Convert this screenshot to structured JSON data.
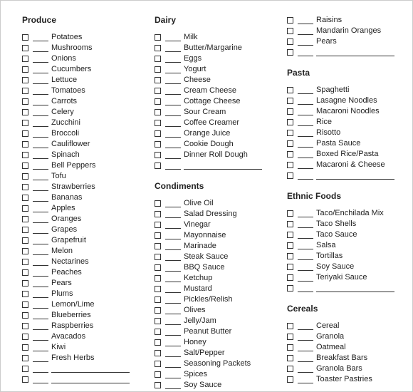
{
  "columns": [
    {
      "sections": [
        {
          "title": "Produce",
          "items": [
            {
              "label": "Potatoes"
            },
            {
              "label": "Mushrooms"
            },
            {
              "label": "Onions"
            },
            {
              "label": "Cucumbers"
            },
            {
              "label": "Lettuce"
            },
            {
              "label": "Tomatoes"
            },
            {
              "label": "Carrots"
            },
            {
              "label": "Celery"
            },
            {
              "label": "Zucchini"
            },
            {
              "label": "Broccoli"
            },
            {
              "label": "Cauliflower"
            },
            {
              "label": "Spinach"
            },
            {
              "label": "Bell Peppers"
            },
            {
              "label": "Tofu"
            },
            {
              "label": "Strawberries"
            },
            {
              "label": "Bananas"
            },
            {
              "label": "Apples"
            },
            {
              "label": "Oranges"
            },
            {
              "label": "Grapes"
            },
            {
              "label": "Grapefruit"
            },
            {
              "label": "Melon"
            },
            {
              "label": "Nectarines"
            },
            {
              "label": "Peaches"
            },
            {
              "label": "Pears"
            },
            {
              "label": "Plums"
            },
            {
              "label": "Lemon/Lime"
            },
            {
              "label": "Blueberries"
            },
            {
              "label": "Raspberries"
            },
            {
              "label": "Avacados"
            },
            {
              "label": "Kiwi"
            },
            {
              "label": "Fresh Herbs"
            },
            {
              "blank": true
            },
            {
              "blank": true
            }
          ]
        }
      ]
    },
    {
      "sections": [
        {
          "title": "Dairy",
          "items": [
            {
              "label": "Milk"
            },
            {
              "label": "Butter/Margarine"
            },
            {
              "label": "Eggs"
            },
            {
              "label": "Yogurt"
            },
            {
              "label": "Cheese"
            },
            {
              "label": "Cream Cheese"
            },
            {
              "label": "Cottage Cheese"
            },
            {
              "label": "Sour Cream"
            },
            {
              "label": "Coffee Creamer"
            },
            {
              "label": "Orange Juice"
            },
            {
              "label": "Cookie Dough"
            },
            {
              "label": "Dinner Roll Dough"
            },
            {
              "blank": true
            }
          ]
        },
        {
          "title": "Condiments",
          "items": [
            {
              "label": "Olive Oil"
            },
            {
              "label": "Salad Dressing"
            },
            {
              "label": "Vinegar"
            },
            {
              "label": "Mayonnaise"
            },
            {
              "label": "Marinade"
            },
            {
              "label": "Steak Sauce"
            },
            {
              "label": "BBQ Sauce"
            },
            {
              "label": "Ketchup"
            },
            {
              "label": "Mustard"
            },
            {
              "label": "Pickles/Relish"
            },
            {
              "label": "Olives"
            },
            {
              "label": "Jelly/Jam"
            },
            {
              "label": "Peanut Butter"
            },
            {
              "label": "Honey"
            },
            {
              "label": "Salt/Pepper"
            },
            {
              "label": "Seasoning Packets"
            },
            {
              "label": "Spices"
            },
            {
              "label": "Soy Sauce"
            }
          ]
        }
      ]
    },
    {
      "sections": [
        {
          "title": "",
          "items": [
            {
              "label": "Raisins"
            },
            {
              "label": "Mandarin Oranges"
            },
            {
              "label": "Pears"
            },
            {
              "blank": true
            }
          ]
        },
        {
          "title": "Pasta",
          "items": [
            {
              "label": "Spaghetti"
            },
            {
              "label": "Lasagne Noodles"
            },
            {
              "label": "Macaroni Noodles"
            },
            {
              "label": "Rice"
            },
            {
              "label": "Risotto"
            },
            {
              "label": "Pasta Sauce"
            },
            {
              "label": "Boxed Rice/Pasta"
            },
            {
              "label": "Macaroni & Cheese"
            },
            {
              "blank": true
            }
          ]
        },
        {
          "title": "Ethnic Foods",
          "items": [
            {
              "label": "Taco/Enchilada Mix"
            },
            {
              "label": "Taco Shells"
            },
            {
              "label": "Taco Sauce"
            },
            {
              "label": "Salsa"
            },
            {
              "label": "Tortillas"
            },
            {
              "label": "Soy Sauce"
            },
            {
              "label": "Teriyaki Sauce"
            },
            {
              "blank": true
            }
          ]
        },
        {
          "title": "Cereals",
          "items": [
            {
              "label": "Cereal"
            },
            {
              "label": "Granola"
            },
            {
              "label": "Oatmeal"
            },
            {
              "label": "Breakfast Bars"
            },
            {
              "label": "Granola Bars"
            },
            {
              "label": "Toaster Pastries"
            }
          ]
        }
      ]
    }
  ]
}
